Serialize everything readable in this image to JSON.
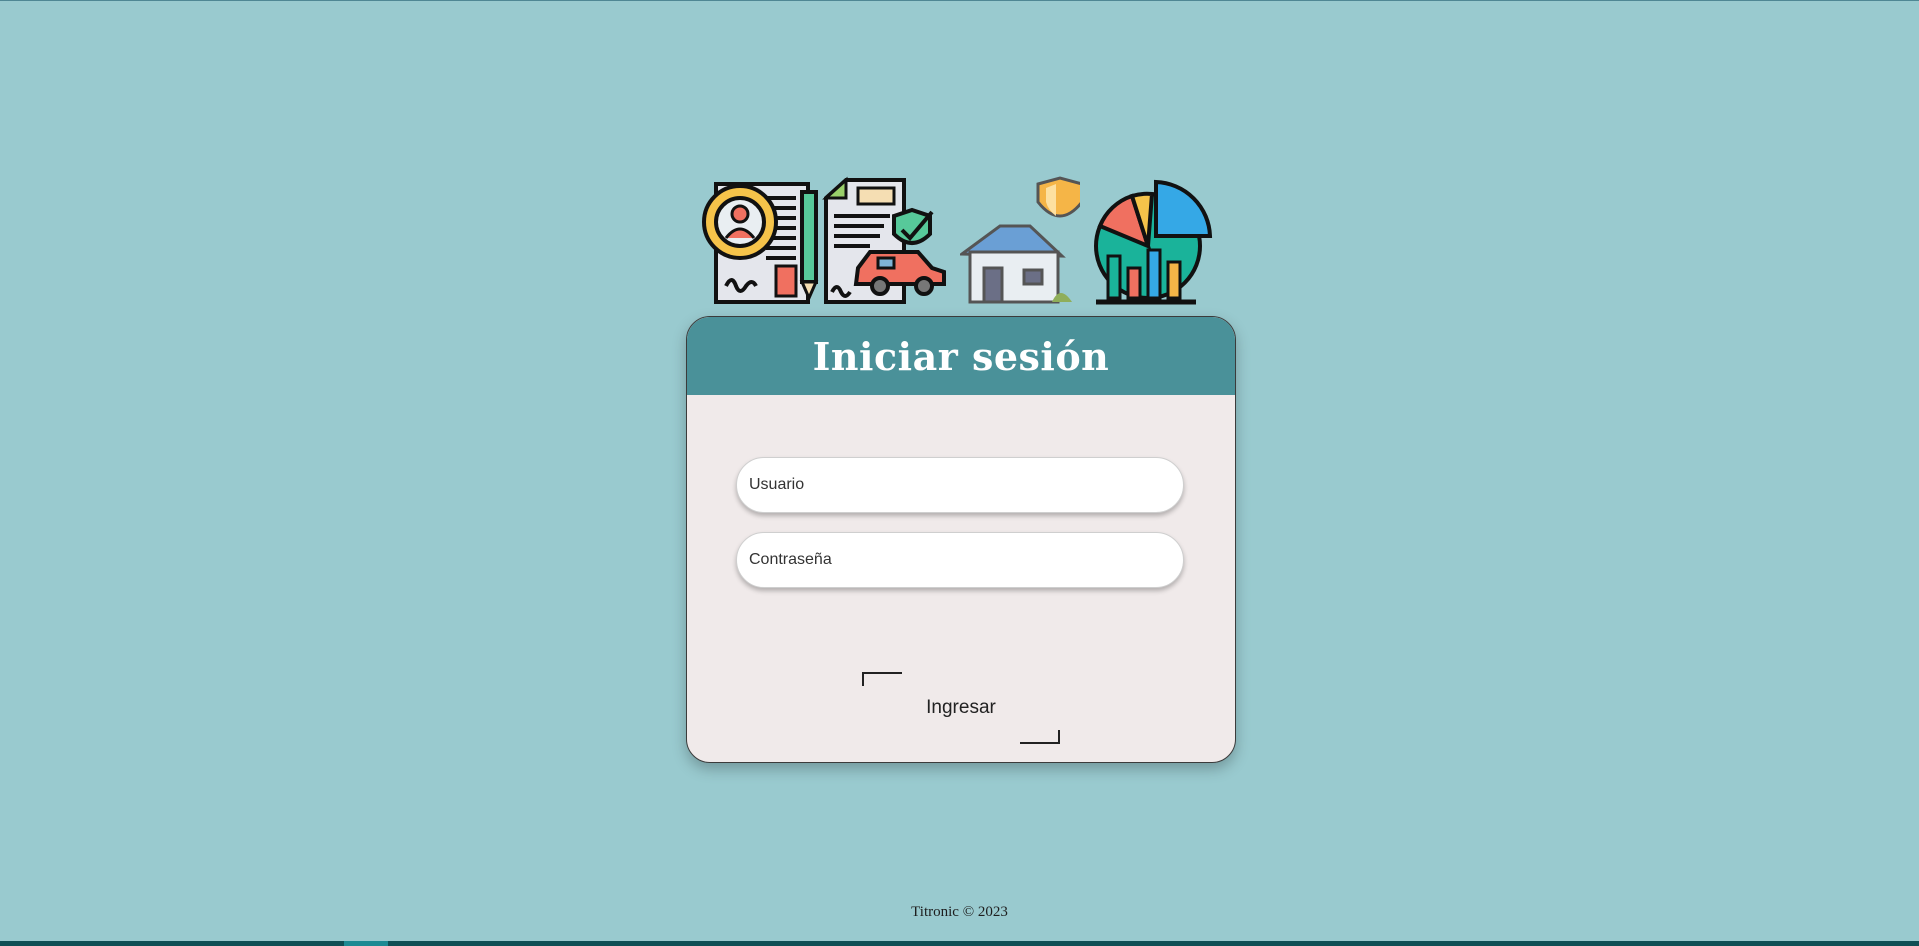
{
  "login": {
    "title": "Iniciar sesión",
    "username_placeholder": "Usuario",
    "password_placeholder": "Contraseña",
    "submit_label": "Ingresar"
  },
  "icons": [
    "certificate-icon",
    "car-insurance-icon",
    "home-insurance-icon",
    "analytics-chart-icon"
  ],
  "footer": {
    "text": "Titronic © 2023"
  },
  "colors": {
    "background": "#99cacf",
    "header": "#4a9199",
    "card": "#f0eaea"
  }
}
